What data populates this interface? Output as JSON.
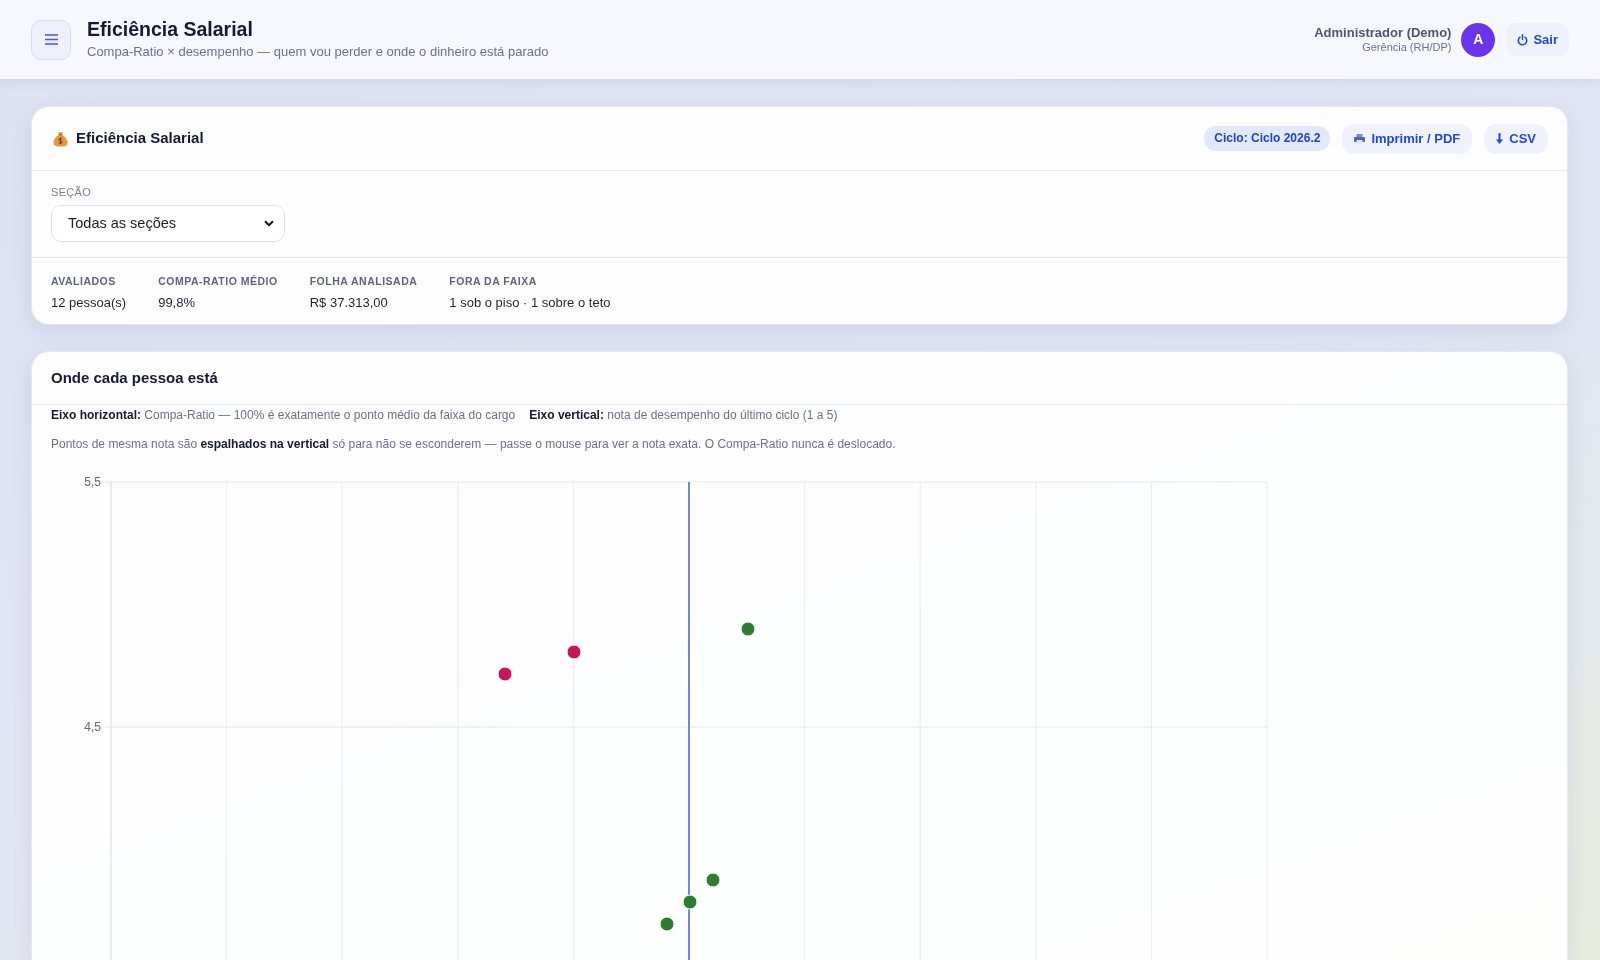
{
  "header": {
    "title": "Eficiência Salarial",
    "subtitle": "Compa-Ratio × desempenho — quem vou perder e onde o dinheiro está parado",
    "user": {
      "name": "Administrador (Demo)",
      "role": "Gerência (RH/DP)",
      "avatar_initial": "A"
    },
    "logout_button": "Sair"
  },
  "summary_card": {
    "title": "Eficiência Salarial",
    "cycle_badge": "Ciclo: Ciclo 2026.2",
    "buttons": [
      {
        "kind": "print",
        "label": "Imprimir / PDF"
      },
      {
        "kind": "download",
        "label": "CSV"
      }
    ],
    "filter": {
      "label": "SEÇÃO",
      "value": "Todas as seções"
    },
    "stats": [
      {
        "label": "AVALIADOS",
        "value": "12 pessoa(s)"
      },
      {
        "label": "COMPA-RATIO MÉDIO",
        "value": "99,8%"
      },
      {
        "label": "FOLHA ANALISADA",
        "value": "R$ 37.313,00"
      },
      {
        "label": "FORA DA FAIXA",
        "value": "1 sob o piso · 1 sobre o teto"
      }
    ]
  },
  "chart_card": {
    "title": "Onde cada pessoa está",
    "axis_notes": [
      "**Eixo horizontal:** Compa-Ratio — 100% é exatamente o ponto médio da faixa do cargo",
      "**Eixo vertical:** nota de desempenho do último ciclo (1 a 5)"
    ],
    "note": "Pontos de mesma nota são **espalhados na vertical** só para não se esconderem — passe o mouse para ver a nota exata. O Compa-Ratio nunca é deslocado.",
    "chart": {
      "y_tick_labels": [
        "5,5",
        "4,5"
      ],
      "points": [
        {
          "color": "#c2185b"
        },
        {
          "color": "#c2185b"
        },
        {
          "color": "#2e7d32"
        },
        {
          "color": "#2e7d32"
        },
        {
          "color": "#2e7d32"
        },
        {
          "color": "#2e7d32"
        }
      ]
    }
  }
}
